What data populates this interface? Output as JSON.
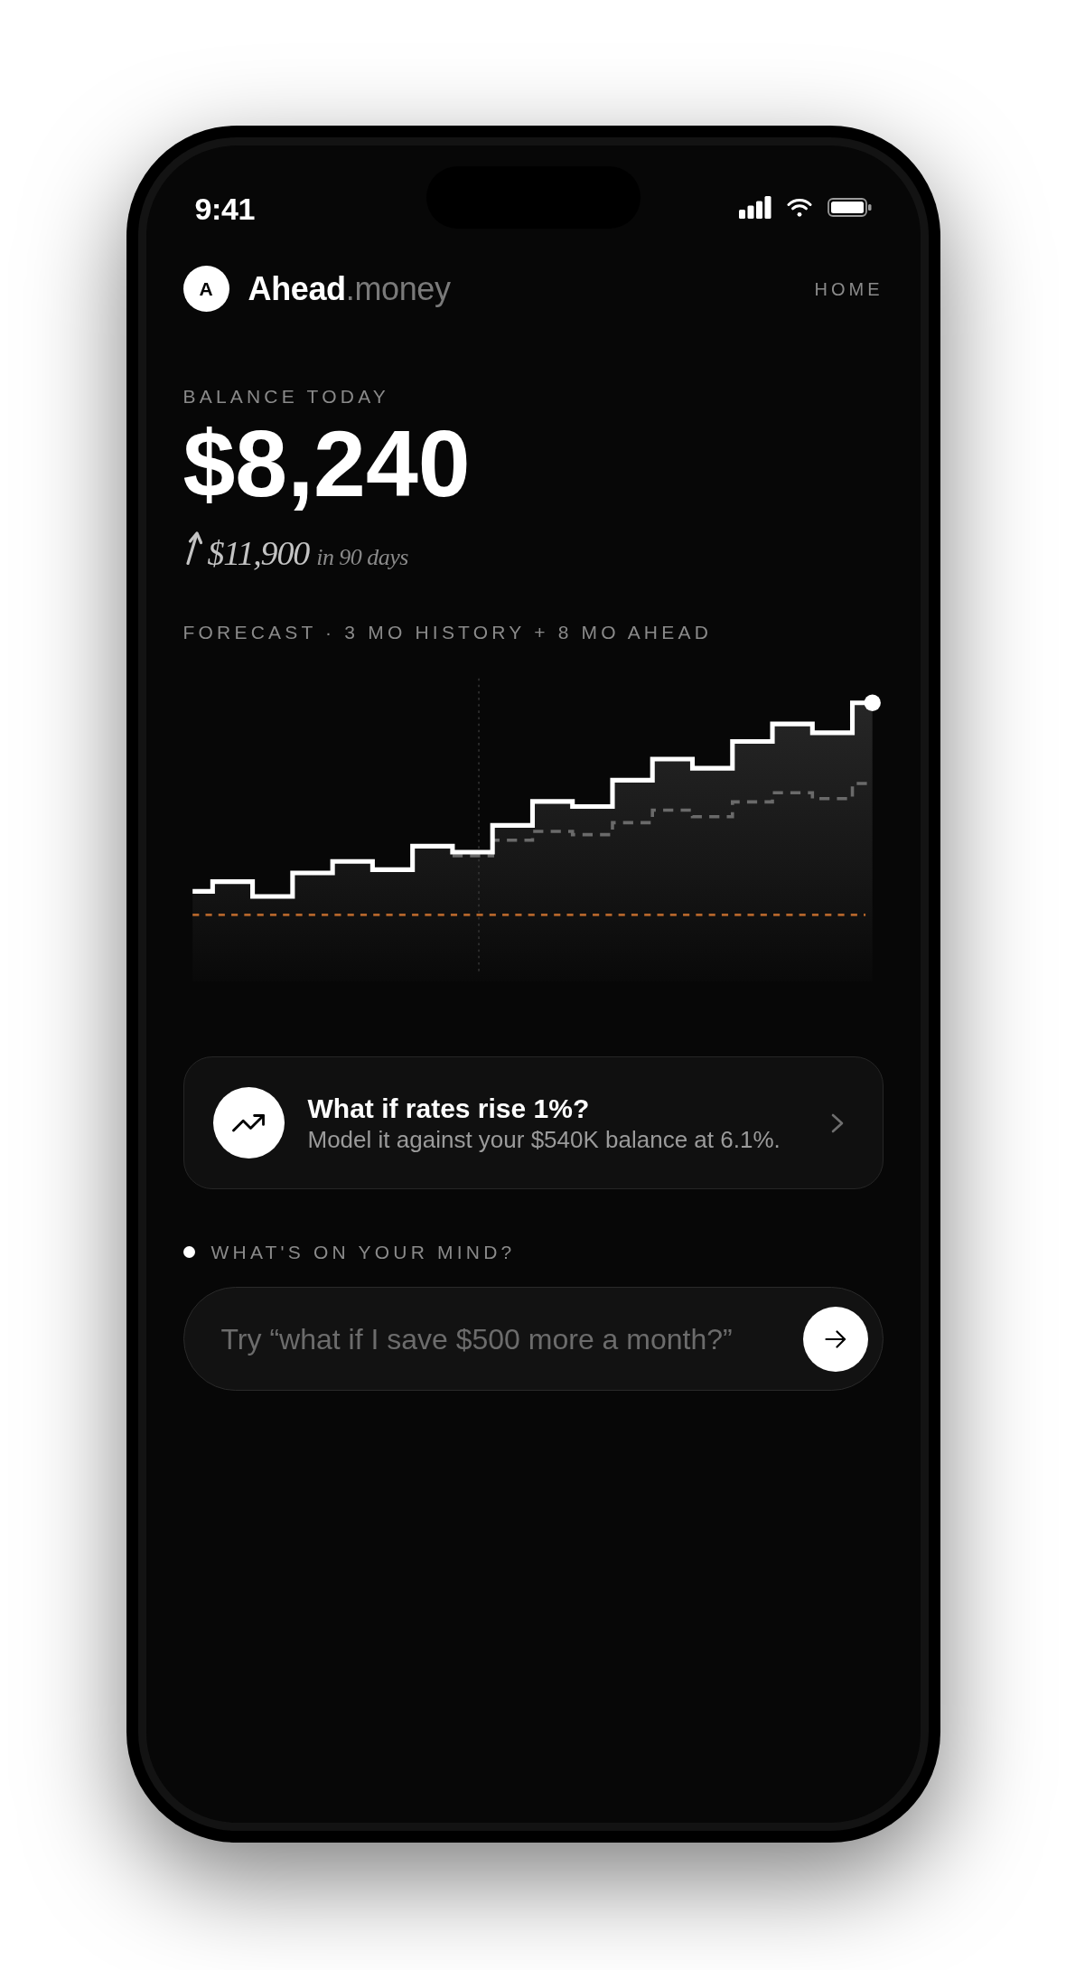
{
  "status_bar": {
    "time": "9:41"
  },
  "header": {
    "logo_mark": "A",
    "brand": "**Ahead**.money",
    "nav_label": "HOME"
  },
  "balance": {
    "label": "BALANCE TODAY",
    "amount": "$8,240",
    "projection": "$11,900",
    "projection_period": "in 90 days"
  },
  "forecast": {
    "label": "FORECAST · 3 MO HISTORY + 8 MO AHEAD"
  },
  "suggestion_card": {
    "title": "What if rates rise 1%?",
    "subtitle": "Model it against your $540K balance at 6.1%."
  },
  "prompt": {
    "label": "WHAT'S ON YOUR MIND?",
    "placeholder": "Try “what if I save $500 more a month?”"
  }
}
